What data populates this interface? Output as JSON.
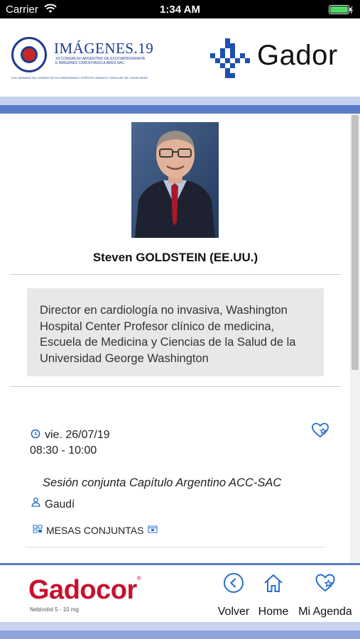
{
  "status_bar": {
    "carrier": "Carrier",
    "time": "1:34 AM"
  },
  "header": {
    "left_logo": {
      "title": "IMÁGENES.19",
      "subtitle": "XII CONGRESO ARGENTINO DE ECOCARDIOGRAFÍA E IMÁGENES CARDIOVASCULARES SAC",
      "footer_line": "XXIV JORNADAS DEL CONSEJO DE ECOCARDIOGRAFÍA Y DOPPLER CARDÍACO Y VASCULAR \"DR. OSCAR ORIAS\""
    },
    "right_logo": {
      "name": "Gador"
    }
  },
  "speaker": {
    "name": "Steven GOLDSTEIN (EE.UU.)",
    "bio": "Director en cardiología no invasiva, Washington Hospital Center Profesor clínico de medicina, Escuela de Medicina y Ciencias de la Salud de la Universidad George Washington"
  },
  "session": {
    "date": "vie. 26/07/19",
    "time": "08:30 - 10:00",
    "title": "Sesión conjunta Capítulo Argentino ACC-SAC",
    "room": "Gaudí",
    "category": "MESAS CONJUNTAS"
  },
  "footer": {
    "brand": "Gadocor",
    "brand_mark": "®",
    "brand_sub": "Nebivolol 5 - 10 mg",
    "nav": {
      "back": "Volver",
      "home": "Home",
      "agenda": "Mi Agenda"
    }
  },
  "colors": {
    "accent_blue": "#5a7bc6",
    "light_blue": "#c7d2ee",
    "icon_blue": "#2a6fc9",
    "brand_red": "#c8102e"
  },
  "icons": {
    "clock": "clock-icon",
    "favorite": "heart-star-icon",
    "room": "person-icon",
    "category": "table-icon",
    "back": "chevron-left-circle-icon",
    "home": "house-icon",
    "agenda": "heart-star-icon"
  },
  "scroll": {
    "thumb_fraction": 0.57
  }
}
